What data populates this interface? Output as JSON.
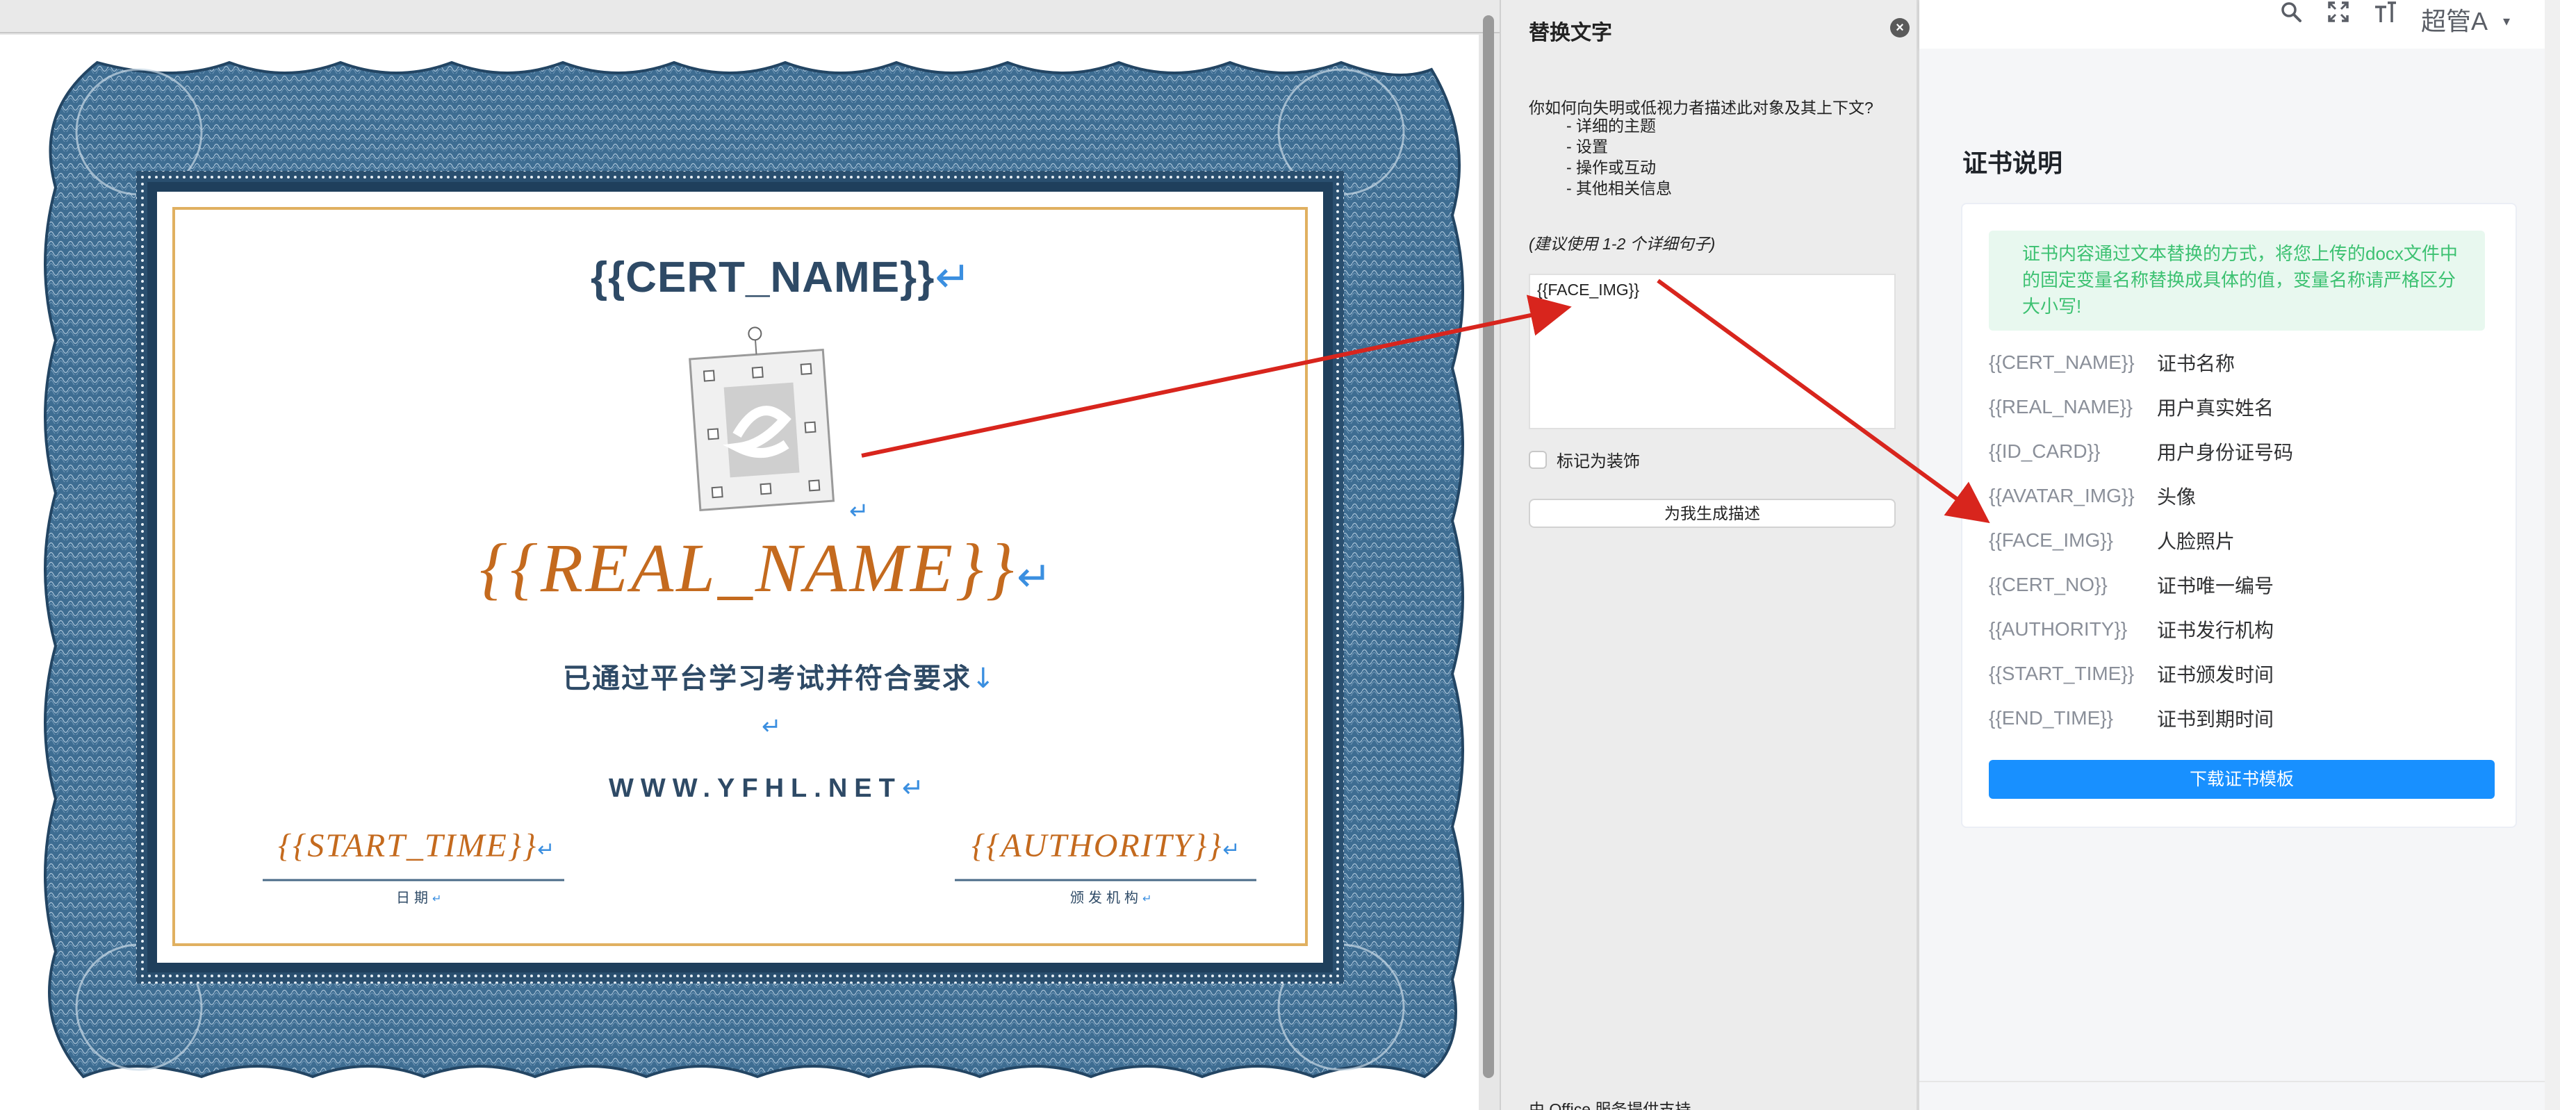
{
  "certificate": {
    "cert_name": "{{CERT_NAME}}",
    "real_name": "{{REAL_NAME}}",
    "description": "已通过平台学习考试并符合要求",
    "website": "WWW.YFHL.NET",
    "start_time": "{{START_TIME}}",
    "authority": "{{AUTHORITY}}",
    "date_label": "日期",
    "authority_label": "颁发机构",
    "paragraph_mark": "↵",
    "line_break_mark": "↓",
    "colors": {
      "border_blue": "#2e5a7e",
      "gold_line": "#e0b060",
      "orange_text": "#c46a1e",
      "dark_blue_text": "#2e4a66"
    }
  },
  "alt_text_pane": {
    "title": "替换文字",
    "close_icon": "close-icon",
    "question": "你如何向失明或低视力者描述此对象及其上下文?",
    "bullets": [
      "- 详细的主题",
      "- 设置",
      "- 操作或互动",
      "- 其他相关信息"
    ],
    "hint": "(建议使用 1-2 个详细句子)",
    "textarea_value": "{{FACE_IMG}}",
    "decorative_label": "标记为装饰",
    "generate_button": "为我生成描述",
    "footer": "由 Office 服务提供支持"
  },
  "app_header": {
    "icons": [
      "search-icon",
      "fullscreen-icon",
      "font-size-icon"
    ],
    "user_name": "超管A",
    "caret": "▾"
  },
  "cert_info": {
    "title": "证书说明",
    "notice": "证书内容通过文本替换的方式，将您上传的docx文件中的固定变量名称替换成具体的值，变量名称请严格区分大小写!",
    "variables": [
      {
        "name": "{{CERT_NAME}}",
        "desc": "证书名称"
      },
      {
        "name": "{{REAL_NAME}}",
        "desc": "用户真实姓名"
      },
      {
        "name": "{{ID_CARD}}",
        "desc": "用户身份证号码"
      },
      {
        "name": "{{AVATAR_IMG}}",
        "desc": "头像"
      },
      {
        "name": "{{FACE_IMG}}",
        "desc": "人脸照片"
      },
      {
        "name": "{{CERT_NO}}",
        "desc": "证书唯一编号"
      },
      {
        "name": "{{AUTHORITY}}",
        "desc": "证书发行机构"
      },
      {
        "name": "{{START_TIME}}",
        "desc": "证书颁发时间"
      },
      {
        "name": "{{END_TIME}}",
        "desc": "证书到期时间"
      }
    ],
    "download_button": "下载证书模板",
    "colors": {
      "primary": "#1890ff",
      "notice_bg": "#e8f8ef",
      "notice_text": "#3cc171"
    }
  },
  "annotation": {
    "arrow_color": "#d8251d"
  }
}
